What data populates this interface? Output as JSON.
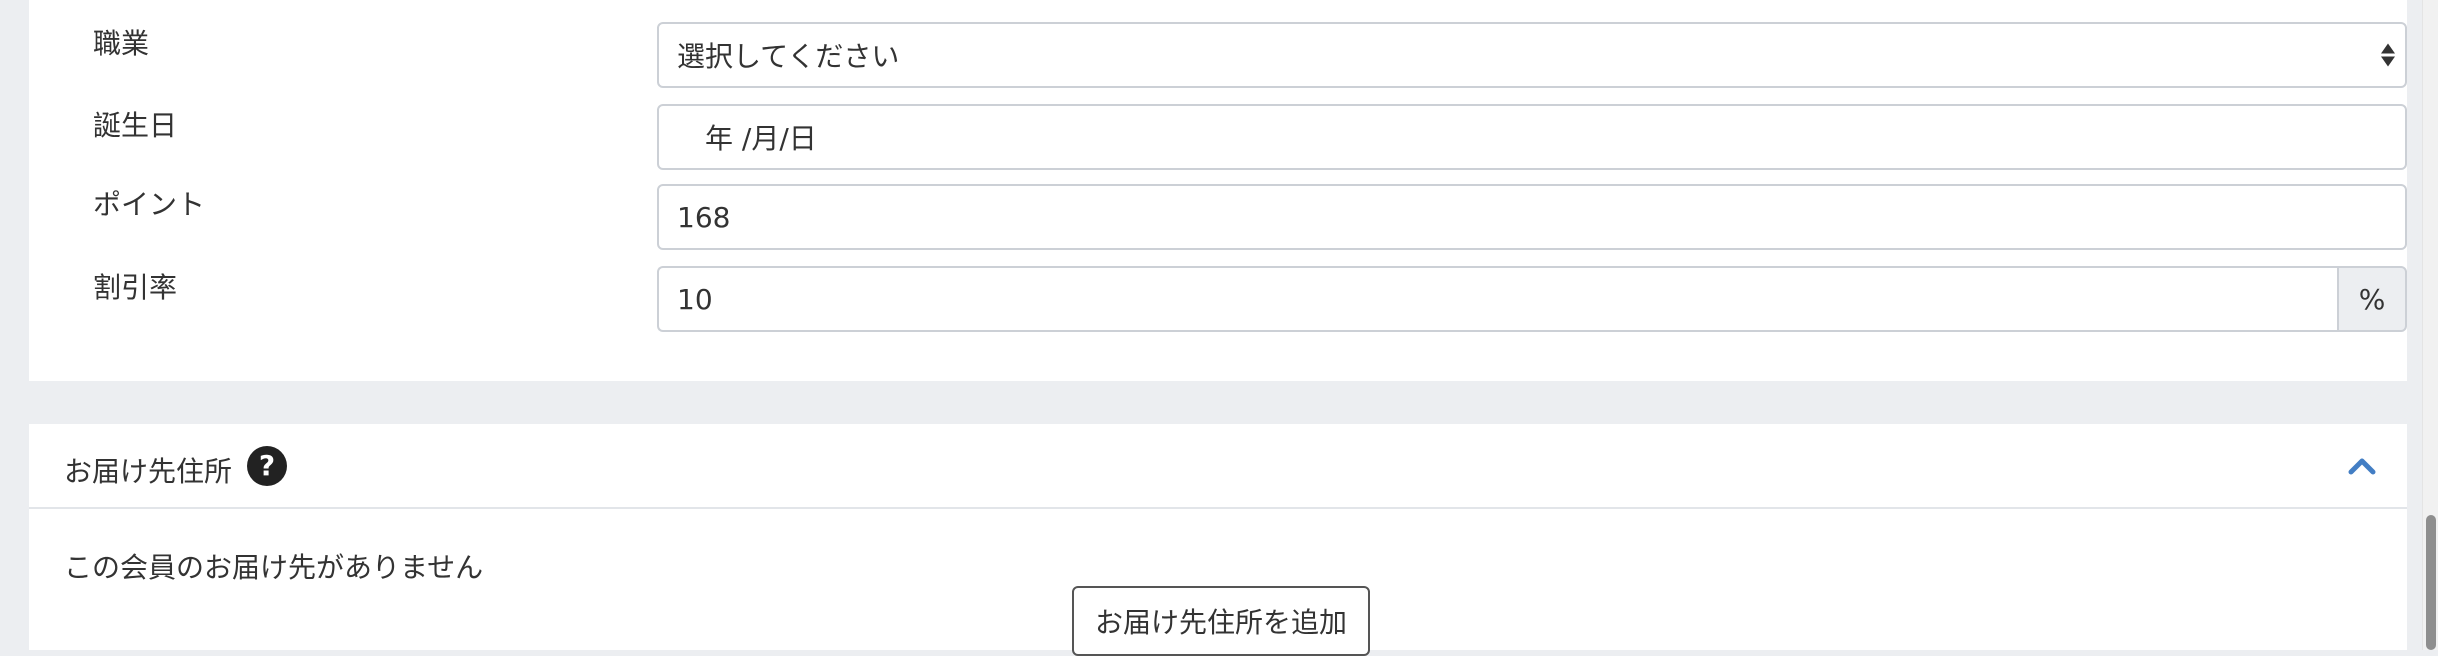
{
  "form": {
    "occupation": {
      "label": "職業",
      "selected": "選択してください"
    },
    "birthday": {
      "label": "誕生日",
      "placeholder": "　年 /月/日"
    },
    "points": {
      "label": "ポイント",
      "value": "168"
    },
    "discount": {
      "label": "割引率",
      "value": "10",
      "unit": "%"
    }
  },
  "delivery": {
    "title": "お届け先住所",
    "help_glyph": "?",
    "empty_message": "この会員のお届け先がありません",
    "add_button_label": "お届け先住所を追加"
  },
  "icons": {
    "help": "question-circle-icon",
    "collapse": "chevron-up-icon",
    "select": "select-arrows-icon"
  },
  "colors": {
    "accent": "#437ec4",
    "background": "#eceef1",
    "card": "#ffffff",
    "border": "#ccd0d6"
  }
}
